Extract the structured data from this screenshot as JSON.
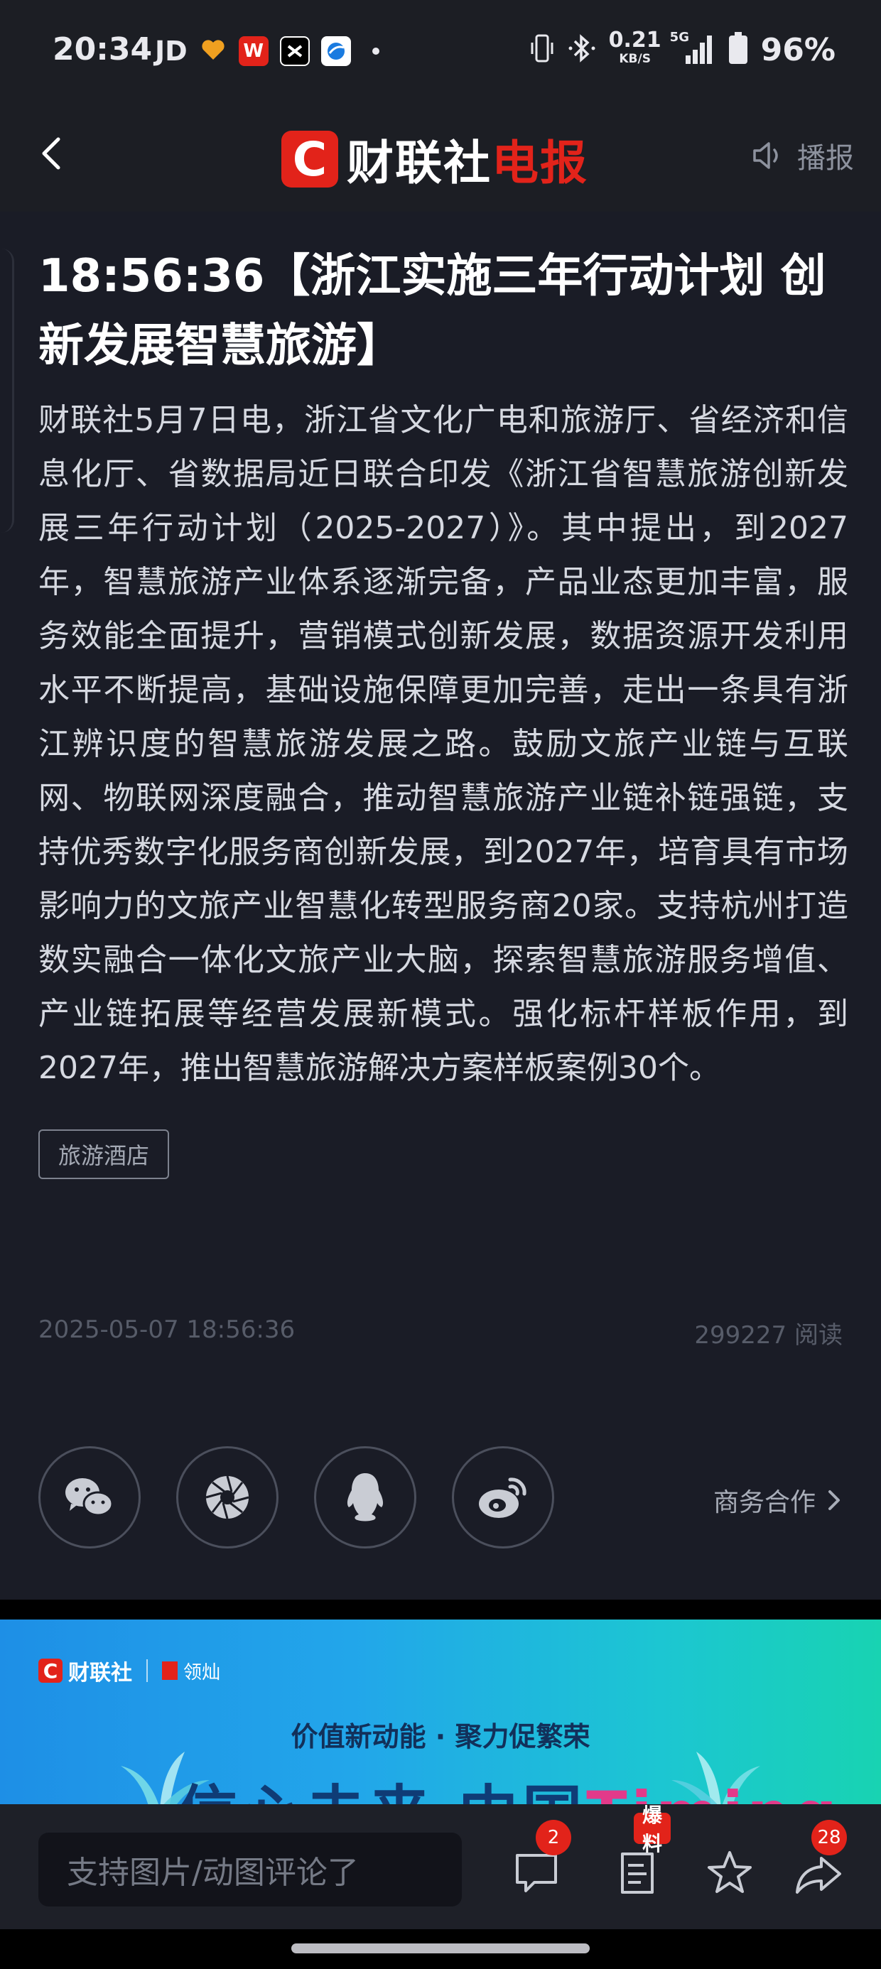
{
  "status_bar": {
    "time": "20:34",
    "jd": "JD",
    "w_app": "W",
    "speed_value": "0.21",
    "speed_unit": "KB/S",
    "network": "5G",
    "battery": "96%"
  },
  "nav": {
    "logo_letter": "C",
    "logo_white": "财联社",
    "logo_red": "电报",
    "broadcast_label": "播报"
  },
  "article": {
    "title": "18:56:36【浙江实施三年行动计划 创新发展智慧旅游】",
    "body": "财联社5月7日电，浙江省文化广电和旅游厅、省经济和信息化厅、省数据局近日联合印发《浙江省智慧旅游创新发展三年行动计划（2025-2027）》。其中提出，到2027年，智慧旅游产业体系逐渐完备，产品业态更加丰富，服务效能全面提升，营销模式创新发展，数据资源开发利用水平不断提高，基础设施保障更加完善，走出一条具有浙江辨识度的智慧旅游发展之路。鼓励文旅产业链与互联网、物联网深度融合，推动智慧旅游产业链补链强链，支持优秀数字化服务商创新发展，到2027年，培育具有市场影响力的文旅产业智慧化转型服务商20家。支持杭州打造数实融合一体化文旅产业大脑，探索智慧旅游服务增值、产业链拓展等经营发展新模式。强化标杆样板作用，到2027年，推出智慧旅游解决方案样板案例30个。",
    "tag": "旅游酒店",
    "datetime": "2025-05-07 18:56:36",
    "reads": "299227 阅读"
  },
  "share": {
    "business_label": "商务合作"
  },
  "banner": {
    "logo_letter": "C",
    "logo_text": "财联社",
    "partner": "领灿",
    "slogan": "价值新动能 · 聚力促繁荣",
    "headline_main": "信心未来 中国",
    "headline_pink": "Timing"
  },
  "bottom_bar": {
    "comment_placeholder": "支持图片/动图评论了",
    "comment_count": "2",
    "baoliao_label": "爆料",
    "share_count": "28"
  },
  "colors": {
    "brand_red": "#e2231a",
    "background": "#1a1c26"
  }
}
